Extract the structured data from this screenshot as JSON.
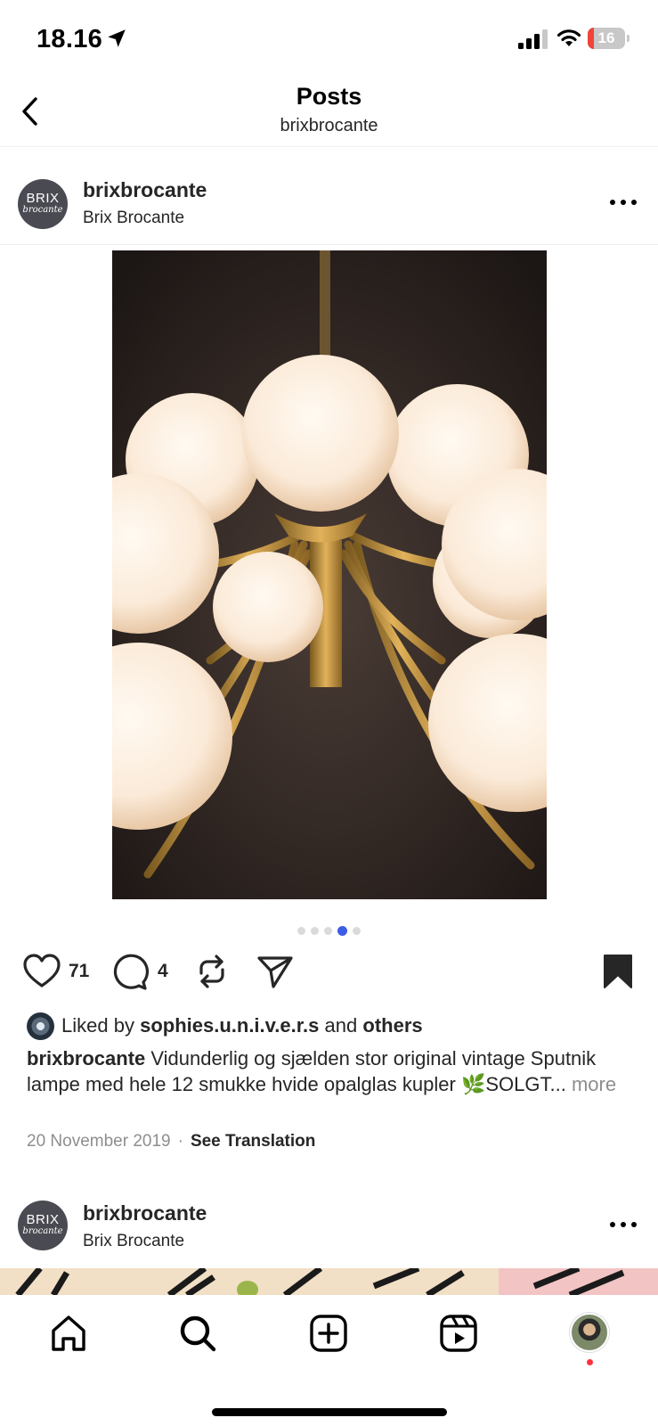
{
  "status_bar": {
    "time": "18.16",
    "battery": "16",
    "battery_level": 0.16,
    "icons": [
      "location-arrow-icon",
      "cellular-signal-icon",
      "wifi-icon",
      "battery-icon"
    ]
  },
  "header": {
    "title": "Posts",
    "subtitle": "brixbrocante",
    "back_icon": "chevron-left-icon"
  },
  "posts": [
    {
      "username": "brixbrocante",
      "display_name": "Brix Brocante",
      "avatar_text": "BRIX",
      "avatar_script": "brocante",
      "carousel": {
        "count": 5,
        "active_index": 3
      },
      "likes": "71",
      "comments": "4",
      "liked_by_prefix": "Liked by",
      "liked_by_user": "sophies.u.n.i.v.e.r.s",
      "liked_by_and": "and",
      "liked_by_others": "others",
      "caption_user": "brixbrocante",
      "caption_text": "Vidunderlig og sjælden stor original vintage Sputnik lampe med hele 12 smukke hvide opalglas kupler 🌿SOLGT...",
      "caption_more": "more",
      "date": "20 November 2019",
      "separator": "·",
      "see_translation": "See Translation"
    },
    {
      "username": "brixbrocante",
      "display_name": "Brix Brocante",
      "avatar_text": "BRIX",
      "avatar_script": "brocante"
    }
  ],
  "actions": {
    "like_icon": "heart-icon",
    "comment_icon": "comment-icon",
    "repost_icon": "repost-icon",
    "share_icon": "send-icon",
    "save_icon": "bookmark-icon"
  },
  "tabbar": {
    "items": [
      "home-icon",
      "search-icon",
      "create-icon",
      "reels-icon",
      "profile-avatar"
    ]
  },
  "colors": {
    "accent_dot": "#3b5de7",
    "notification_dot": "#ff3040",
    "text": "#262626",
    "muted": "#8e8e8e"
  }
}
